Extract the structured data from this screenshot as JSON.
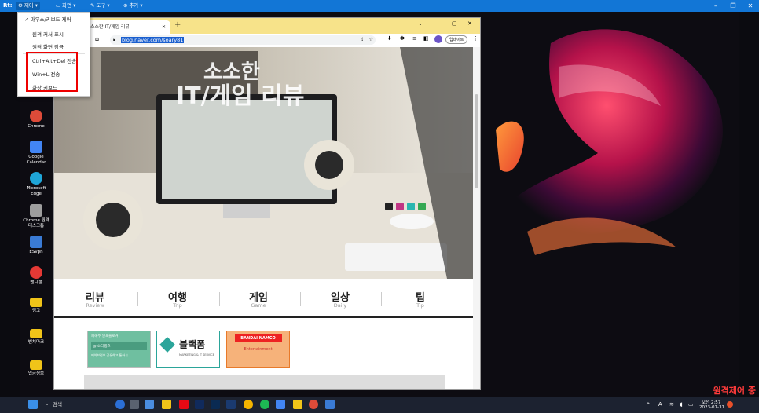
{
  "remote_bar": {
    "logo": "Rt:",
    "menus": [
      {
        "label": "제어",
        "active": true
      },
      {
        "label": "화면",
        "active": false
      },
      {
        "label": "도구",
        "active": false
      },
      {
        "label": "추가",
        "active": false
      }
    ]
  },
  "dropdown": {
    "items": [
      {
        "label": "마우스/키보드 제어",
        "checked": true
      },
      {
        "label": "원격 커서 표시",
        "checked": false
      },
      {
        "label": "원격 화면 잠금",
        "checked": false
      },
      {
        "label": "Ctrl+Alt+Del 전송",
        "checked": false
      },
      {
        "label": "Win+L 전송",
        "checked": false
      },
      {
        "label": "화상 키보드",
        "checked": false
      }
    ]
  },
  "desktop_icons": [
    {
      "label": "Chrome",
      "color": "#dd4b39"
    },
    {
      "label": "Google Calendar",
      "color": "#4285f4"
    },
    {
      "label": "Microsoft Edge",
      "color": "#1fa6d8"
    },
    {
      "label": "Chrome 원격 데스크톱",
      "color": "#9e9e9e"
    },
    {
      "label": "ESvpn",
      "color": "#3a7bd5"
    },
    {
      "label": "밴디캠",
      "color": "#e53935"
    },
    {
      "label": "링고",
      "color": "#f0c419"
    },
    {
      "label": "벤치마크",
      "color": "#f0c419"
    },
    {
      "label": "입금정보",
      "color": "#f0c419"
    }
  ],
  "browser": {
    "tab_title": "소소한 IT/게임 리뷰",
    "new_tab": "+",
    "url": "blog.naver.com/soary81",
    "profile_label": "업데이트",
    "hero_heading_line1": "소소한",
    "hero_heading_line2": "IT/게임 리뷰",
    "categories": [
      {
        "name": "리뷰",
        "sub": "Review"
      },
      {
        "name": "여행",
        "sub": "Trip"
      },
      {
        "name": "게임",
        "sub": "Game"
      },
      {
        "name": "일상",
        "sub": "Daily"
      },
      {
        "name": "팁",
        "sub": "Tip"
      }
    ],
    "banners": [
      {
        "title": "피해주 인포블로거",
        "subtitle": "@ 소라팽츠",
        "footer": "에이브런으 공유하고 통하시"
      },
      {
        "title": "블랙폼",
        "subtitle": "MARKETING & IT SERVICE"
      },
      {
        "title": "BANDAI NAMCO",
        "subtitle": "Entertainment"
      }
    ]
  },
  "taskbar": {
    "search_placeholder": "검색",
    "time": "오전 2:57",
    "date": "2023-07-31",
    "tray_lang": "A"
  },
  "remote_status": "원격제어 중",
  "colors": {
    "accent": "#1276d6",
    "highlight_box": "#ee0000",
    "tab_strip": "#f7e38a"
  }
}
